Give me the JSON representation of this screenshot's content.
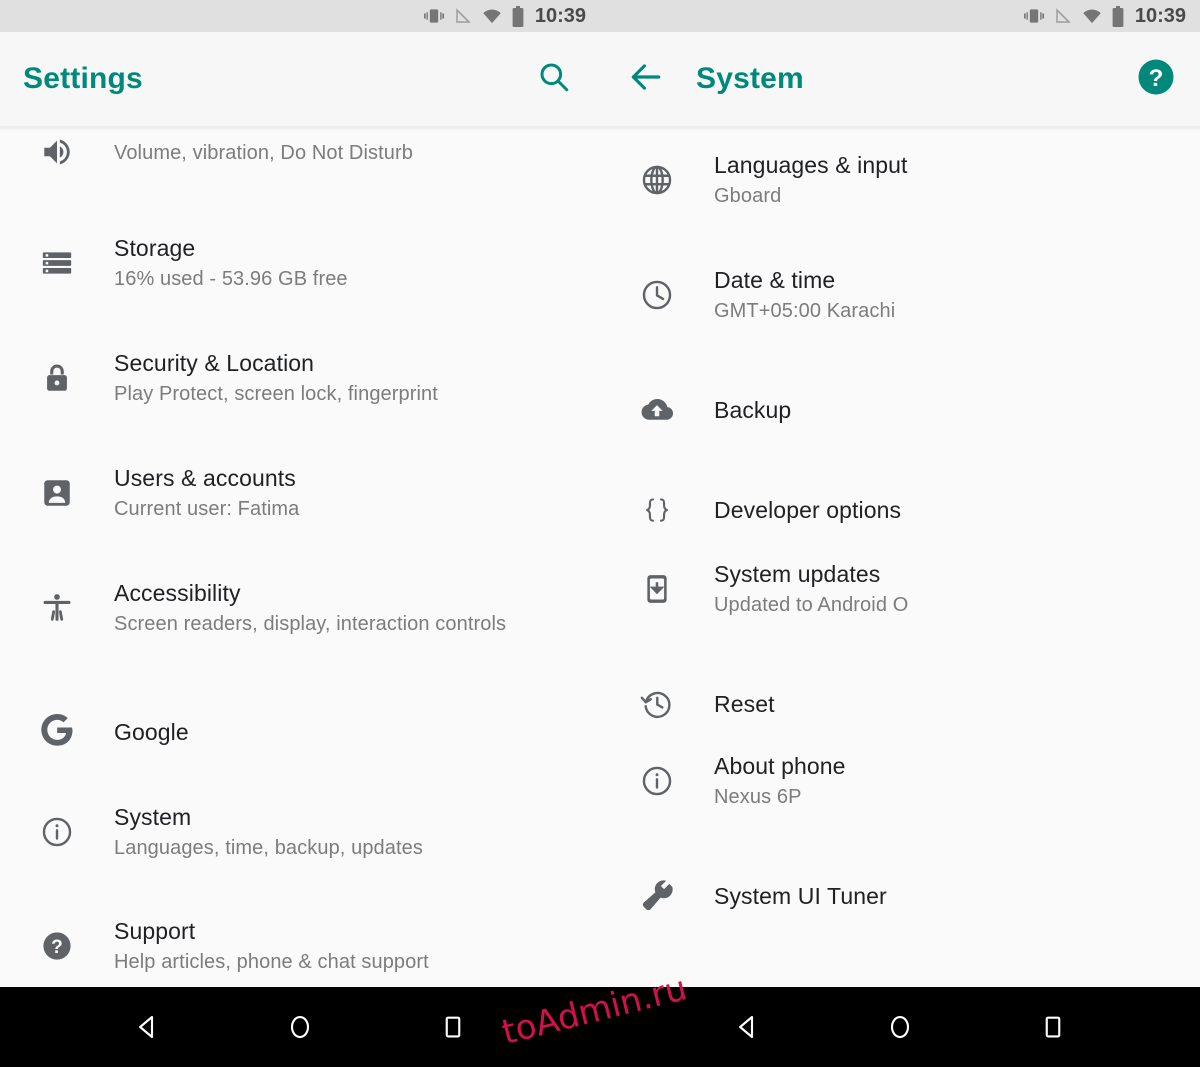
{
  "status_bar": {
    "time": "10:39",
    "icons": [
      "vibrate-icon",
      "sim-off-icon",
      "wifi-icon",
      "battery-icon"
    ],
    "background_color": "#e0e0e0"
  },
  "theme": {
    "accent_color": "#00897b",
    "background_color": "#fafafa",
    "appbar_color": "#f7f7f7",
    "title_text_color": "#202124",
    "subtitle_text_color": "#7c7c7c",
    "icon_color": "#5f6368",
    "navbar_color": "#000000",
    "watermark_color": "#d2104a"
  },
  "left_pane": {
    "appbar": {
      "title": "Settings",
      "search_label": "search-icon"
    },
    "items": [
      {
        "title": "",
        "subtitle": "Volume, vibration, Do Not Disturb",
        "icon": "sound-icon",
        "partial": true
      },
      {
        "title": "Storage",
        "subtitle": "16% used - 53.96 GB free",
        "icon": "storage-icon"
      },
      {
        "title": "Security & Location",
        "subtitle": "Play Protect, screen lock, fingerprint",
        "icon": "lock-icon"
      },
      {
        "title": "Users & accounts",
        "subtitle": "Current user: Fatima",
        "icon": "account-box-icon"
      },
      {
        "title": "Accessibility",
        "subtitle": "Screen readers, display, interaction controls",
        "icon": "accessibility-icon"
      },
      {
        "title": "Google",
        "subtitle": "",
        "icon": "google-g-icon"
      },
      {
        "title": "System",
        "subtitle": "Languages, time, backup, updates",
        "icon": "info-circle-icon"
      },
      {
        "title": "Support",
        "subtitle": "Help articles, phone & chat support",
        "icon": "help-filled-icon"
      }
    ]
  },
  "right_pane": {
    "appbar": {
      "title": "System",
      "back_label": "back-arrow-icon",
      "help_label": "help-icon"
    },
    "items": [
      {
        "title": "Languages & input",
        "subtitle": "Gboard",
        "icon": "globe-icon"
      },
      {
        "title": "Date & time",
        "subtitle": "GMT+05:00 Karachi",
        "icon": "clock-icon"
      },
      {
        "title": "Backup",
        "subtitle": "",
        "icon": "cloud-upload-icon"
      },
      {
        "title": "Developer options",
        "subtitle": "",
        "icon": "braces-icon"
      },
      {
        "title": "System updates",
        "subtitle": "Updated to Android O",
        "icon": "phone-download-icon"
      },
      {
        "title": "Reset",
        "subtitle": "",
        "icon": "restore-icon"
      },
      {
        "title": "About phone",
        "subtitle": "Nexus 6P",
        "icon": "info-circle-icon"
      },
      {
        "title": "System UI Tuner",
        "subtitle": "",
        "icon": "wrench-icon"
      }
    ]
  },
  "nav_bar": {
    "buttons": [
      "back-triangle-icon",
      "home-circle-icon",
      "recents-square-icon"
    ]
  },
  "watermark": {
    "text": "toAdmin.ru"
  }
}
